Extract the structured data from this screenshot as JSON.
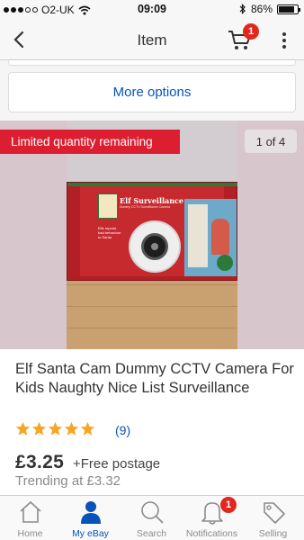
{
  "status_bar": {
    "carrier": "O2-UK",
    "time": "09:09",
    "battery": "86%",
    "battery_level": 0.86,
    "icons": [
      "signal-dots-icon",
      "wifi-icon",
      "bluetooth-icon",
      "battery-icon"
    ]
  },
  "nav": {
    "title": "Item",
    "cart_count": "1",
    "icons": [
      "back-arrow-icon",
      "cart-icon",
      "more-vertical-icon"
    ]
  },
  "more_options": {
    "label": "More options"
  },
  "gallery": {
    "limited_banner": "Limited quantity remaining",
    "counter": "1 of 4",
    "photo": {
      "box_title": "Elf Surveillance",
      "box_subtitle": "Dummy CCTV Surveillance Camera",
      "box_text": "Elfs reports bad behaviour to Santa",
      "logo_text": "Elves Behavin' Badly"
    }
  },
  "item": {
    "title": "Elf Santa Cam Dummy CCTV Camera For Kids Naughty Nice List Surveillance",
    "rating_stars": 5,
    "review_count": "(9)",
    "price": "£3.25",
    "postage": "+Free postage",
    "trending": "Trending at £3.32"
  },
  "tabs": [
    {
      "label": "Home",
      "icon": "home-icon",
      "active": false
    },
    {
      "label": "My eBay",
      "icon": "person-icon",
      "active": true
    },
    {
      "label": "Search",
      "icon": "search-icon",
      "active": false
    },
    {
      "label": "Notifications",
      "icon": "bell-icon",
      "active": false,
      "badge": "1"
    },
    {
      "label": "Selling",
      "icon": "tag-icon",
      "active": false
    }
  ],
  "colors": {
    "accent_blue": "#0654ba",
    "banner_red": "#dd1e31",
    "badge_red": "#e0281f",
    "star_orange": "#f5a623"
  }
}
